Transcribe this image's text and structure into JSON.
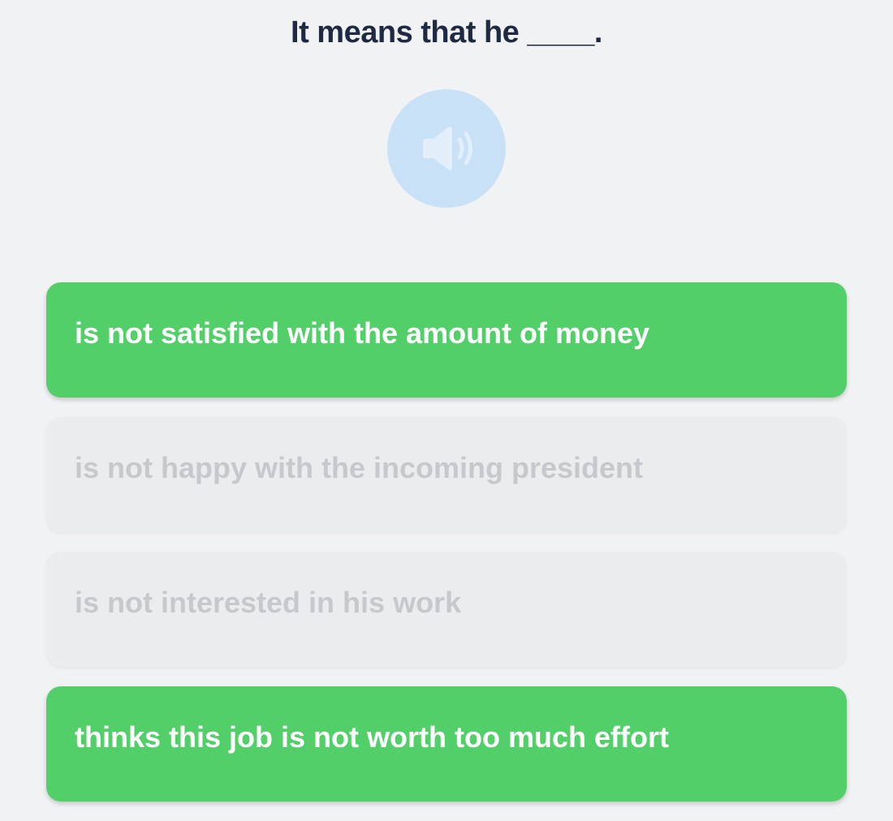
{
  "question": {
    "text": "It means that he ____."
  },
  "audio": {
    "icon": "speaker-icon",
    "color": "#c8e1f7",
    "icon_color": "#e2effb"
  },
  "options": [
    {
      "text": "is not satisfied with the amount of money",
      "state": "selected"
    },
    {
      "text": "is not happy with the incoming president",
      "state": "disabled"
    },
    {
      "text": "is not interested in his work",
      "state": "disabled"
    },
    {
      "text": "thinks this job is not worth too much effort",
      "state": "selected"
    }
  ],
  "colors": {
    "selected": "#53cf6a",
    "disabled": "#ebecee",
    "disabled_text": "#c6c8cd",
    "heading": "#1e2a44",
    "background": "#f1f2f4"
  }
}
